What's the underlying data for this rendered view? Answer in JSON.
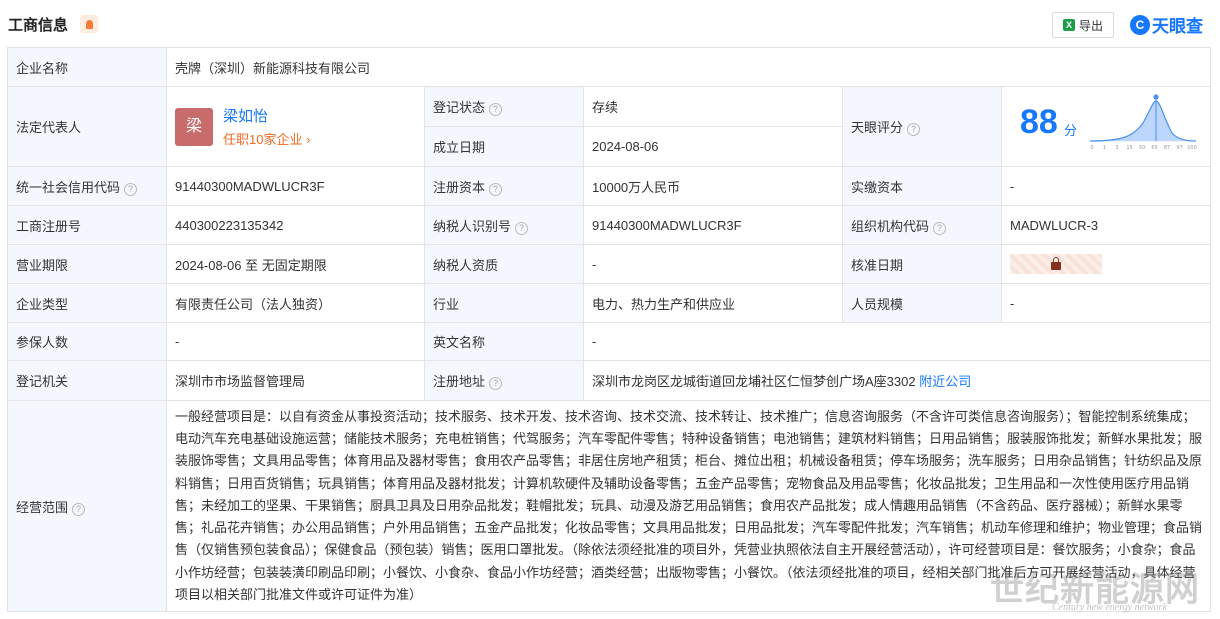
{
  "header": {
    "title": "工商信息",
    "export_label": "导出",
    "brand_logo_char": "C",
    "brand_name": "天眼查"
  },
  "rows": {
    "company_name": {
      "label": "企业名称",
      "value": "壳牌（深圳）新能源科技有限公司"
    },
    "legal_rep": {
      "label": "法定代表人",
      "avatar_char": "梁",
      "name": "梁如怡",
      "sub": "任职10家企业 ›"
    },
    "reg_status": {
      "label": "登记状态",
      "value": "存续"
    },
    "found_date": {
      "label": "成立日期",
      "value": "2024-08-06"
    },
    "score": {
      "label": "天眼评分",
      "value": "88",
      "unit": "分",
      "axis_ticks": [
        "0",
        "1",
        "3",
        "15",
        "50",
        "65",
        "87",
        "97",
        "100"
      ]
    },
    "credit_code": {
      "label": "统一社会信用代码",
      "value": "91440300MADWLUCR3F"
    },
    "reg_capital": {
      "label": "注册资本",
      "value": "10000万人民币"
    },
    "paid_capital": {
      "label": "实缴资本",
      "value": "-"
    },
    "reg_no": {
      "label": "工商注册号",
      "value": "440300223135342"
    },
    "taxpayer_id": {
      "label": "纳税人识别号",
      "value": "91440300MADWLUCR3F"
    },
    "org_code": {
      "label": "组织机构代码",
      "value": "MADWLUCR-3"
    },
    "term": {
      "label": "营业期限",
      "value": "2024-08-06 至 无固定期限"
    },
    "taxpayer_qual": {
      "label": "纳税人资质",
      "value": "-"
    },
    "approve_date": {
      "label": "核准日期"
    },
    "company_type": {
      "label": "企业类型",
      "value": "有限责任公司（法人独资）"
    },
    "industry": {
      "label": "行业",
      "value": "电力、热力生产和供应业"
    },
    "staff_size": {
      "label": "人员规模",
      "value": "-"
    },
    "insured": {
      "label": "参保人数",
      "value": "-"
    },
    "english_name": {
      "label": "英文名称",
      "value": "-"
    },
    "authority": {
      "label": "登记机关",
      "value": "深圳市市场监督管理局"
    },
    "address": {
      "label": "注册地址",
      "value": "深圳市龙岗区龙城街道回龙埔社区仁恒梦创广场A座3302",
      "link": "附近公司"
    },
    "scope": {
      "label": "经营范围",
      "value": "一般经营项目是：以自有资金从事投资活动；技术服务、技术开发、技术咨询、技术交流、技术转让、技术推广；信息咨询服务（不含许可类信息咨询服务）；智能控制系统集成；电动汽车充电基础设施运营；储能技术服务；充电桩销售；代驾服务；汽车零配件零售；特种设备销售；电池销售；建筑材料销售；日用品销售；服装服饰批发；新鲜水果批发；服装服饰零售；文具用品零售；体育用品及器材零售；食用农产品零售；非居住房地产租赁；柜台、摊位出租；机械设备租赁；停车场服务；洗车服务；日用杂品销售；针纺织品及原料销售；日用百货销售；玩具销售；体育用品及器材批发；计算机软硬件及辅助设备零售；五金产品零售；宠物食品及用品零售；化妆品批发；卫生用品和一次性使用医疗用品销售；未经加工的坚果、干果销售；厨具卫具及日用杂品批发；鞋帽批发；玩具、动漫及游艺用品销售；食用农产品批发；成人情趣用品销售（不含药品、医疗器械）；新鲜水果零售；礼品花卉销售；办公用品销售；户外用品销售；五金产品批发；化妆品零售；文具用品批发；日用品批发；汽车零配件批发；汽车销售；机动车修理和维护；物业管理；食品销售（仅销售预包装食品）；保健食品（预包装）销售；医用口罩批发。（除依法须经批准的项目外，凭营业执照依法自主开展经营活动），许可经营项目是：餐饮服务；小食杂；食品小作坊经营；包装装潢印刷品印刷；小餐饮、小食杂、食品小作坊经营；酒类经营；出版物零售；小餐饮。（依法须经批准的项目，经相关部门批准后方可开展经营活动，具体经营项目以相关部门批准文件或许可证件为准）"
    }
  },
  "watermark": {
    "main": "世纪新能源网",
    "sub": "Century new energy network"
  }
}
